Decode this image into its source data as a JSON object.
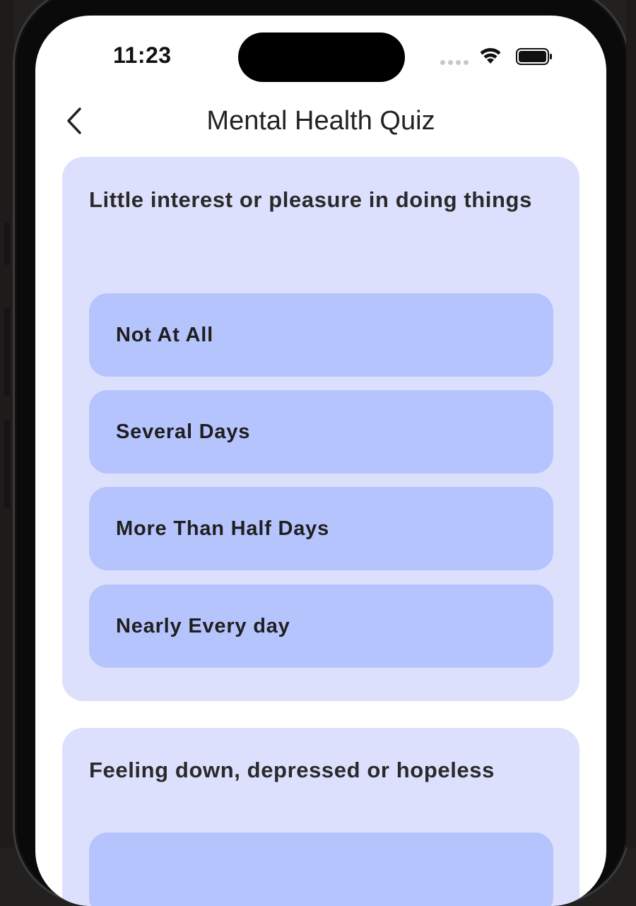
{
  "status_bar": {
    "time": "11:23",
    "icons": [
      "signal-dots-icon",
      "wifi-icon",
      "battery-icon"
    ]
  },
  "nav": {
    "back_icon": "chevron-left-icon",
    "title": "Mental Health Quiz"
  },
  "questions": [
    {
      "text": "Little interest or pleasure in doing things",
      "options": [
        {
          "label": "Not At All"
        },
        {
          "label": "Several Days"
        },
        {
          "label": "More Than Half Days"
        },
        {
          "label": "Nearly Every day"
        }
      ]
    },
    {
      "text": "Feeling down, depressed or hopeless",
      "options": []
    }
  ],
  "colors": {
    "card_background": "#dde0fd",
    "option_background": "#b6c4fd",
    "screen_background": "#ffffff"
  }
}
